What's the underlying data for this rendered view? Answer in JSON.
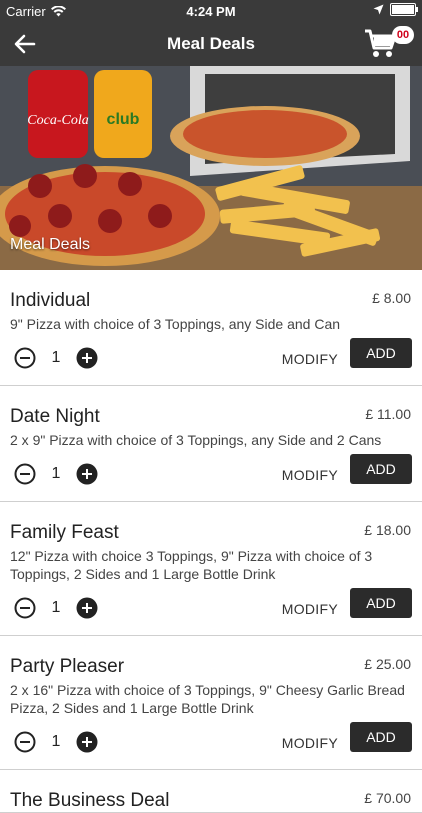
{
  "status_bar": {
    "carrier": "Carrier",
    "time": "4:24 PM"
  },
  "header": {
    "title": "Meal Deals",
    "cart_count": "00"
  },
  "hero": {
    "caption": "Meal Deals"
  },
  "items": [
    {
      "name": "Individual",
      "price": "£  8.00",
      "description": "9\" Pizza with choice of 3 Toppings, any Side and Can",
      "quantity": "1",
      "modify_label": "MODIFY",
      "add_label": "ADD"
    },
    {
      "name": "Date Night",
      "price": "£  11.00",
      "description": "2 x 9\" Pizza with choice of 3 Toppings, any Side and 2 Cans",
      "quantity": "1",
      "modify_label": "MODIFY",
      "add_label": "ADD"
    },
    {
      "name": "Family Feast",
      "price": "£  18.00",
      "description": "12\" Pizza with choice 3 Toppings, 9\" Pizza with choice of 3 Toppings, 2 Sides and 1 Large Bottle Drink",
      "quantity": "1",
      "modify_label": "MODIFY",
      "add_label": "ADD"
    },
    {
      "name": "Party Pleaser",
      "price": "£  25.00",
      "description": "2 x 16\" Pizza with choice of 3 Toppings, 9\" Cheesy Garlic Bread Pizza, 2 Sides and 1 Large Bottle Drink",
      "quantity": "1",
      "modify_label": "MODIFY",
      "add_label": "ADD"
    },
    {
      "name": "The Business Deal",
      "price": "£  70.00",
      "description": "",
      "quantity": "",
      "modify_label": "",
      "add_label": ""
    }
  ]
}
